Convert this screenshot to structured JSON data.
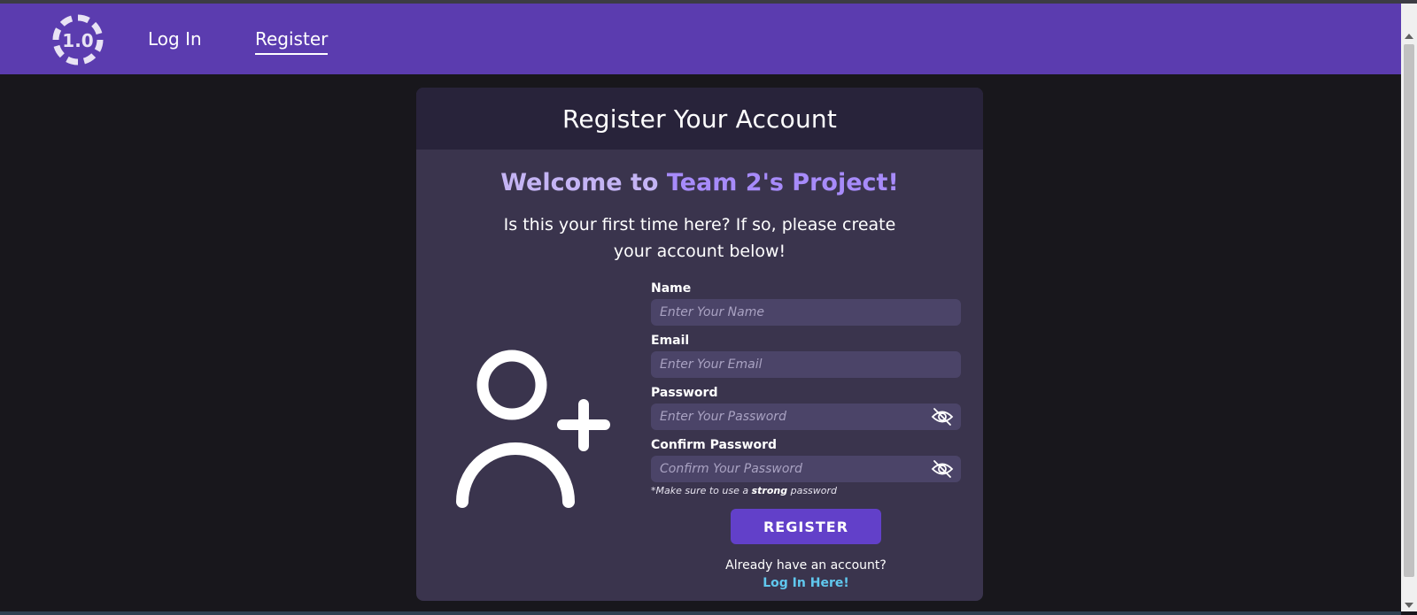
{
  "nav": {
    "logo_text": "1.0",
    "links": [
      {
        "label": "Log In",
        "active": false
      },
      {
        "label": "Register",
        "active": true
      }
    ]
  },
  "card": {
    "title": "Register Your Account",
    "welcome_prefix": "Welcome to ",
    "welcome_accent": "Team 2's Project!",
    "intro": "Is this your first time here? If so, please create your account below!",
    "icon": "user-plus-icon"
  },
  "form": {
    "name": {
      "label": "Name",
      "placeholder": "Enter Your Name",
      "value": ""
    },
    "email": {
      "label": "Email",
      "placeholder": "Enter Your Email",
      "value": ""
    },
    "password": {
      "label": "Password",
      "placeholder": "Enter Your Password",
      "value": "",
      "icon": "eye-slash-icon"
    },
    "confirm": {
      "label": "Confirm Password",
      "placeholder": "Confirm Your Password",
      "value": "",
      "icon": "eye-slash-icon"
    },
    "hint_prefix": "*Make sure to use a ",
    "hint_strong": "strong",
    "hint_suffix": " password",
    "submit_label": "REGISTER"
  },
  "footer": {
    "already": "Already have an account?",
    "login_link": "Log In Here!"
  },
  "colors": {
    "navbar": "#5b3caf",
    "background": "#18171c",
    "card": "#3a344d",
    "card_header": "#28233a",
    "button": "#6240c9",
    "link": "#60c8ee"
  }
}
